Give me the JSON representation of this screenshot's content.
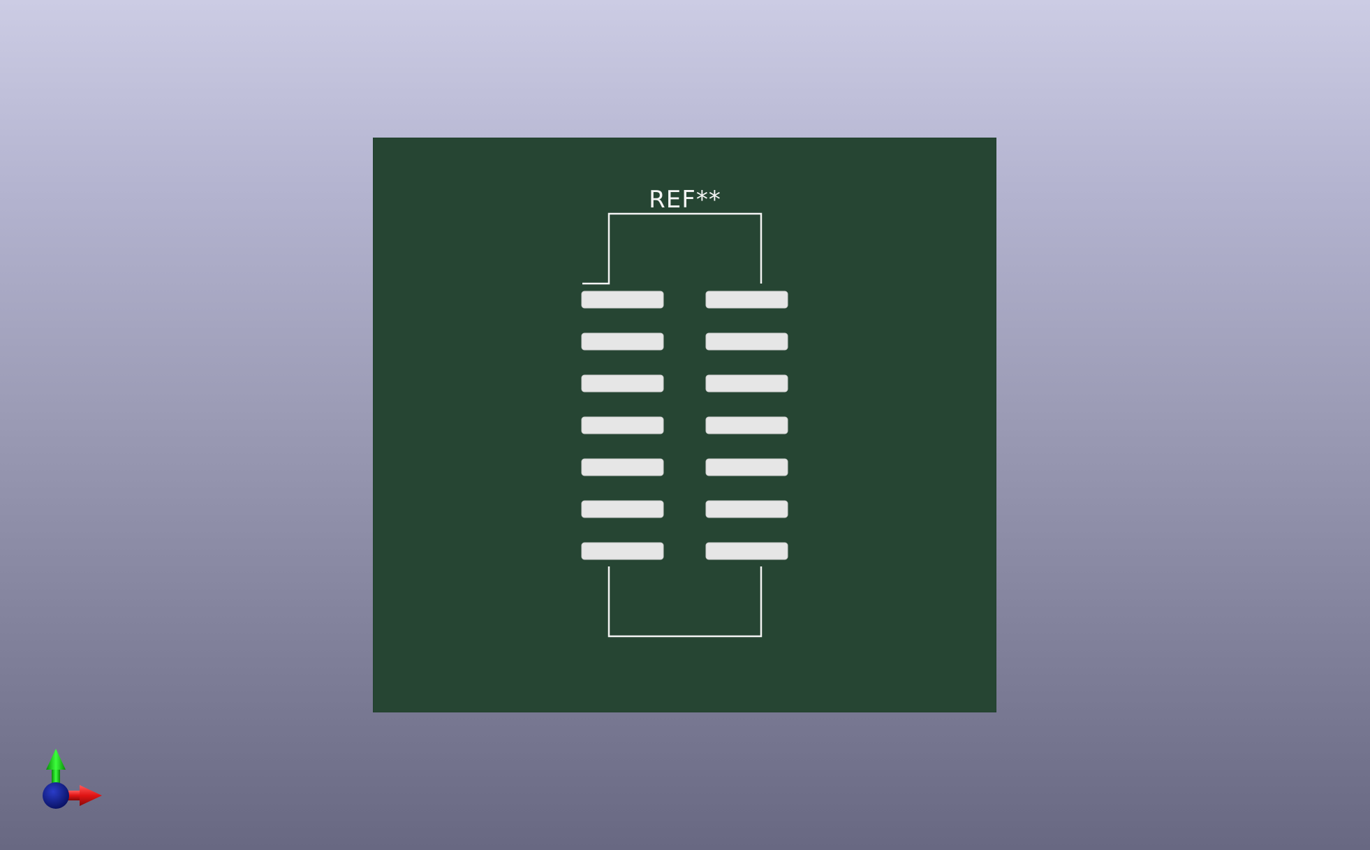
{
  "viewer": {
    "background_top": "#cccce4",
    "background_bottom": "#686882"
  },
  "board": {
    "substrate_color": "#264533",
    "silkscreen_color": "#f4f4f4",
    "pad_color": "#e6e6e6",
    "reference_label": "REF**",
    "pad_rows": 7,
    "pad_columns": 2
  },
  "axis_gizmo": {
    "x_color": "#e01414",
    "y_color": "#14d214",
    "z_color": "#0a1a8c",
    "icons": [
      "x-axis-arrow-icon",
      "y-axis-arrow-icon",
      "z-axis-sphere-icon"
    ]
  }
}
